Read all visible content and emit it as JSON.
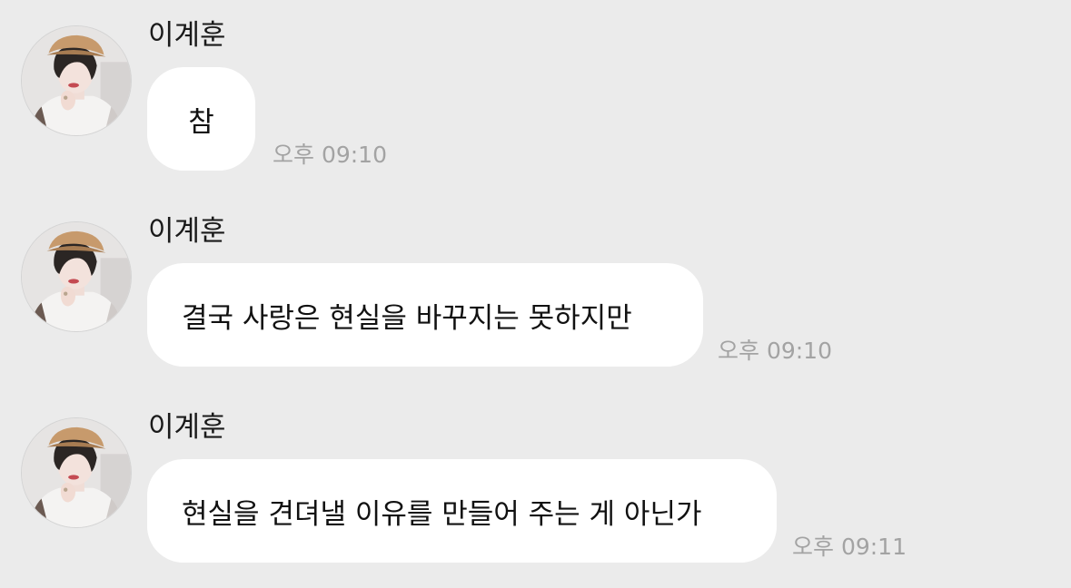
{
  "messages": [
    {
      "sender": "이계훈",
      "text": "참",
      "time": "오후 09:10"
    },
    {
      "sender": "이계훈",
      "text": "결국 사랑은 현실을 바꾸지는 못하지만",
      "time": "오후 09:10"
    },
    {
      "sender": "이계훈",
      "text": "현실을 견뎌낼 이유를 만들어 주는 게 아닌가",
      "time": "오후 09:11"
    }
  ],
  "colors": {
    "background": "#ebebeb",
    "bubble": "#ffffff",
    "time_text": "#a3a3a3"
  }
}
